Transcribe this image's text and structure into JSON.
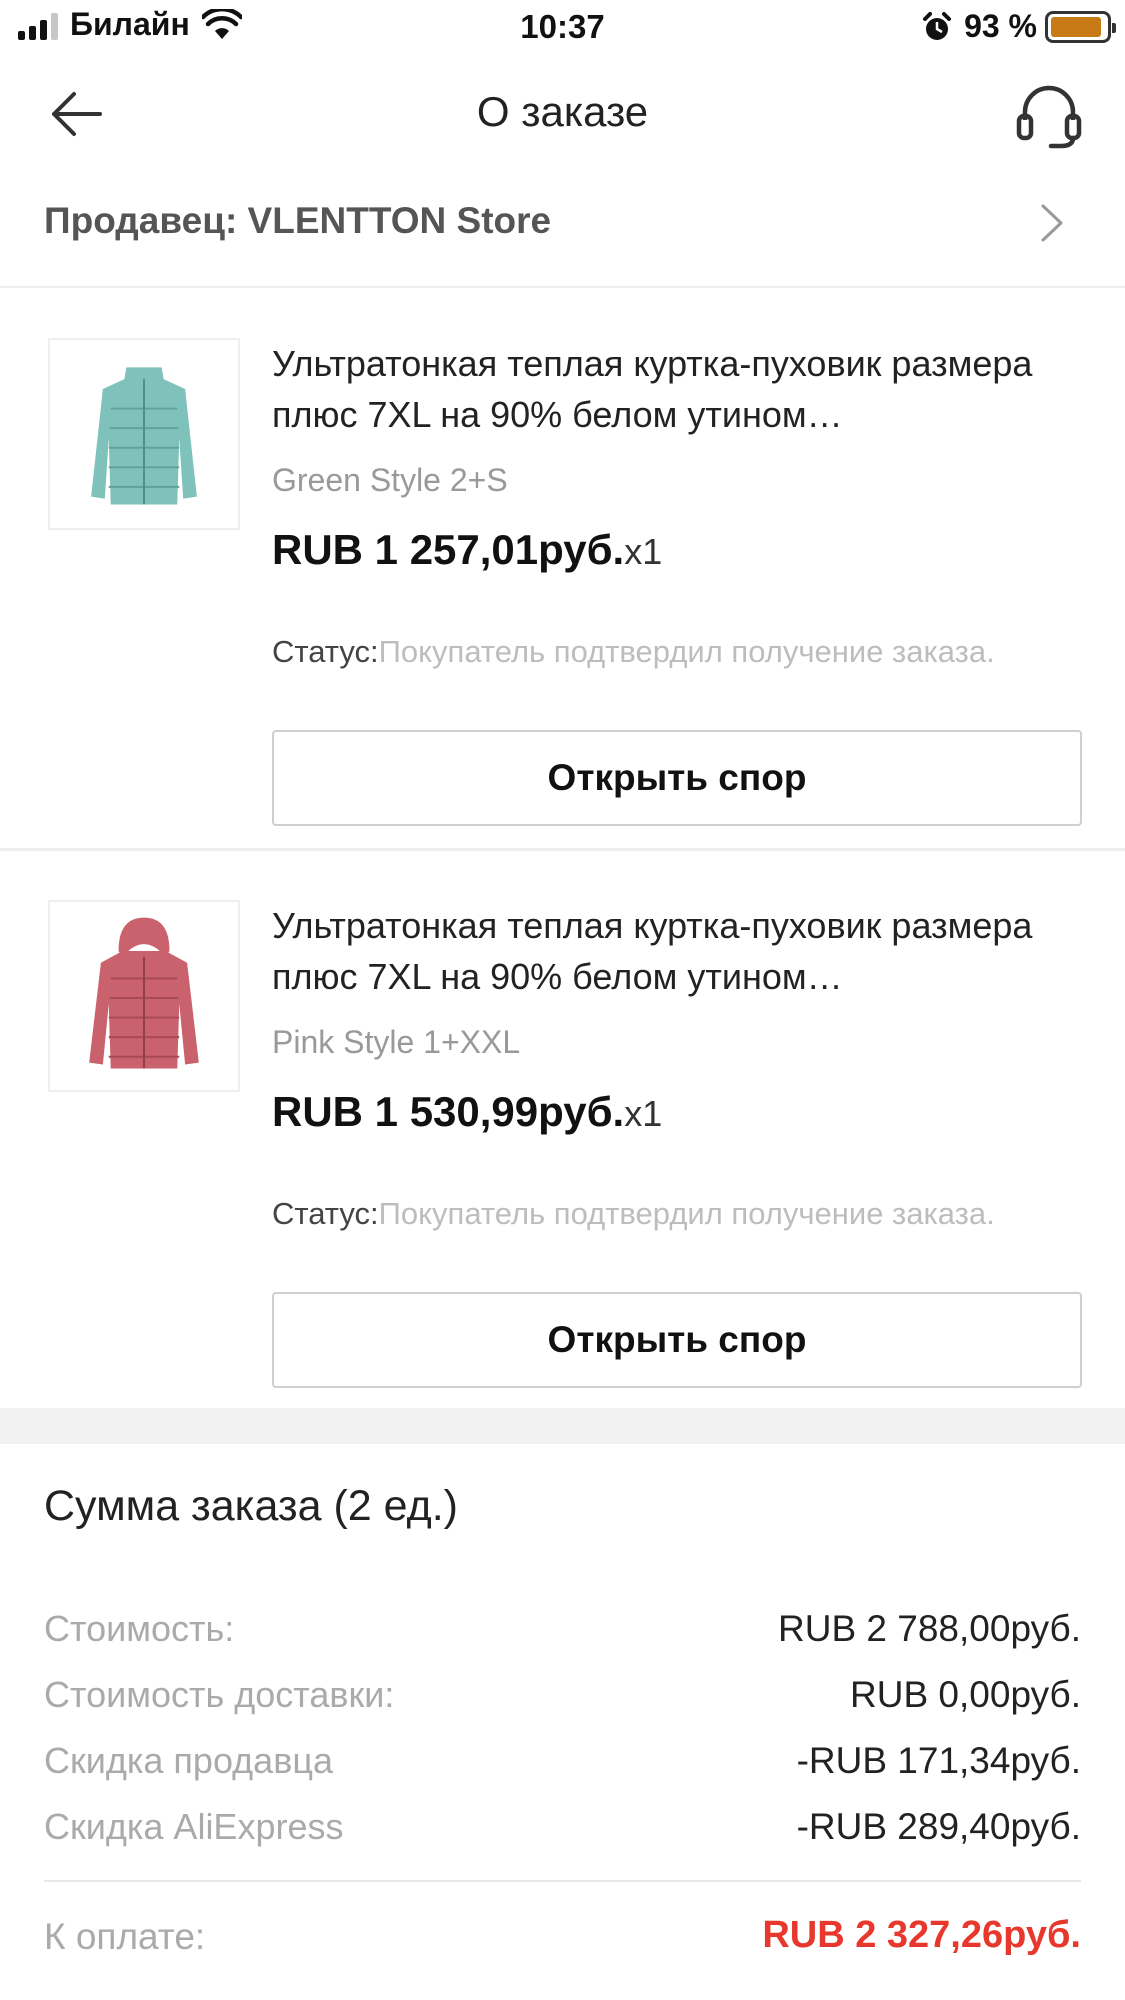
{
  "status_bar": {
    "carrier": "Билайн",
    "time": "10:37",
    "battery_percent": "93 %",
    "battery_level": 0.93
  },
  "nav": {
    "title": "О заказе"
  },
  "seller": {
    "label": "Продавец: VLENTTON Store"
  },
  "products": [
    {
      "title": "Ультратонкая теплая куртка-пуховик размера плюс 7XL на 90% белом утином…",
      "variant": "Green  Style 2+S",
      "price": "RUB 1 257,01руб.",
      "qty": "x1",
      "status_label": "Статус:",
      "status_value": "Покупатель подтвердил получение заказа.",
      "button": "Открыть спор",
      "jacket_color": "#7fc2bb"
    },
    {
      "title": "Ультратонкая теплая куртка-пуховик размера плюс 7XL на 90% белом утином…",
      "variant": "Pink  Style 1+XXL",
      "price": "RUB 1 530,99руб.",
      "qty": "x1",
      "status_label": "Статус:",
      "status_value": "Покупатель подтвердил получение заказа.",
      "button": "Открыть спор",
      "jacket_color": "#c9626d"
    }
  ],
  "summary": {
    "title": "Сумма заказа (2 ед.)",
    "rows": [
      {
        "label": "Стоимость:",
        "value": "RUB 2 788,00руб."
      },
      {
        "label": "Стоимость доставки:",
        "value": "RUB 0,00руб."
      },
      {
        "label": "Скидка продавца",
        "value": "-RUB 171,34руб."
      },
      {
        "label": "Скидка AliExpress",
        "value": "-RUB 289,40руб."
      }
    ],
    "total_label": "К оплате:",
    "total_value": "RUB 2 327,26руб.",
    "total_color": "#e8372c"
  }
}
